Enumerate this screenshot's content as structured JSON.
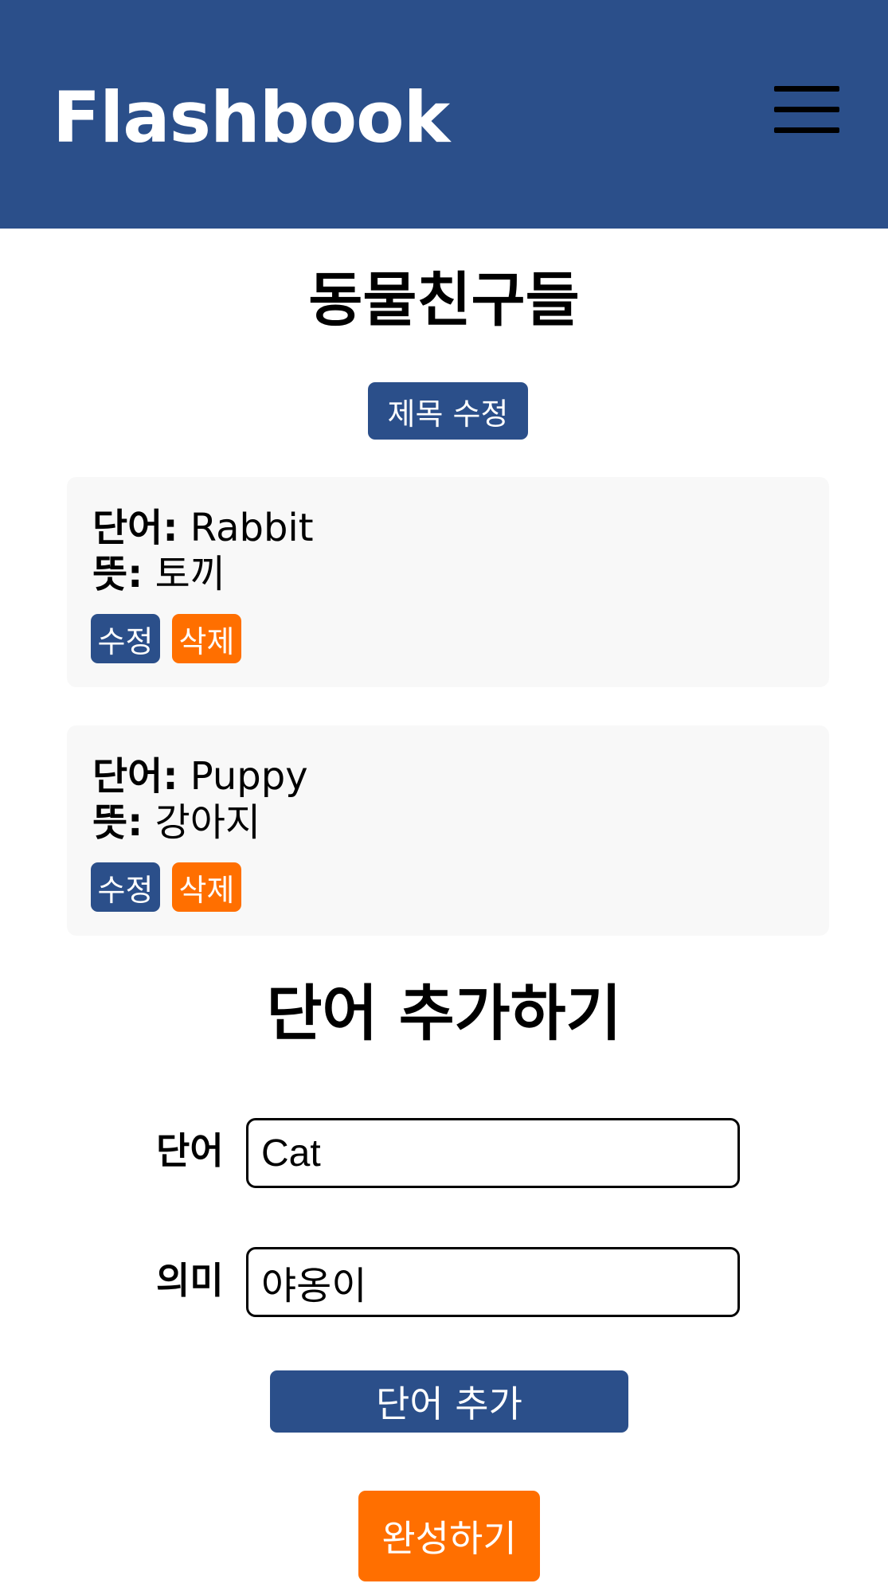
{
  "header": {
    "logo": "Flashbook",
    "menu_icon": "hamburger-menu-icon",
    "background_color": "#2b4f8a"
  },
  "deck": {
    "title": "동물친구들",
    "edit_title_label": "제목 수정"
  },
  "labels": {
    "word": "단어:",
    "meaning": "뜻:"
  },
  "cards": [
    {
      "word": "Rabbit",
      "meaning": "토끼",
      "edit_label": "수정",
      "delete_label": "삭제"
    },
    {
      "word": "Puppy",
      "meaning": "강아지",
      "edit_label": "수정",
      "delete_label": "삭제"
    }
  ],
  "add_form": {
    "title": "단어 추가하기",
    "word_label": "단어",
    "word_value": "Cat",
    "meaning_label": "의미",
    "meaning_value": "야옹이",
    "add_button_label": "단어 추가",
    "done_button_label": "완성하기"
  },
  "colors": {
    "primary": "#2b4f8a",
    "accent": "#ff6f00",
    "card_background": "#f8f8f8"
  }
}
